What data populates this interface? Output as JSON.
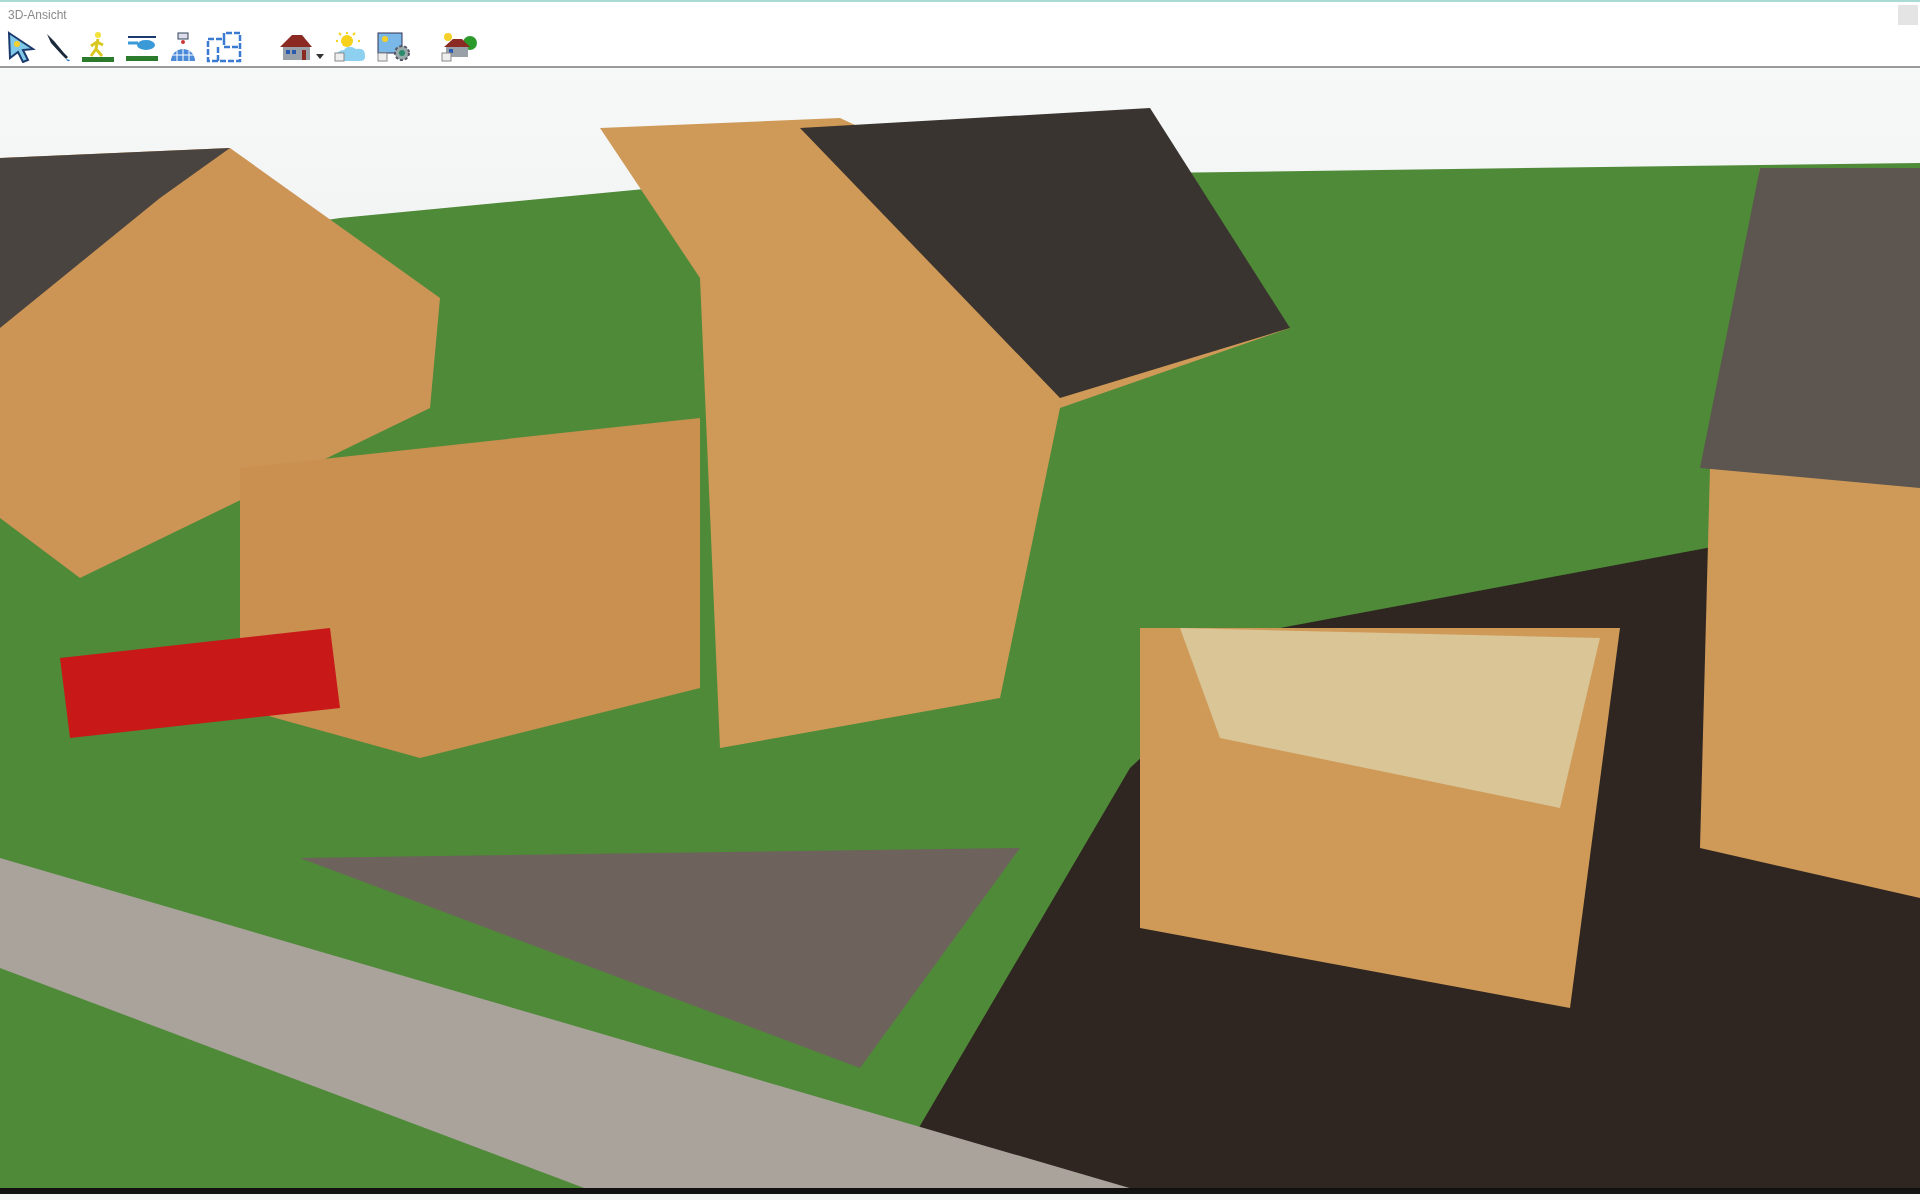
{
  "window": {
    "title": "3D-Ansicht"
  }
}
